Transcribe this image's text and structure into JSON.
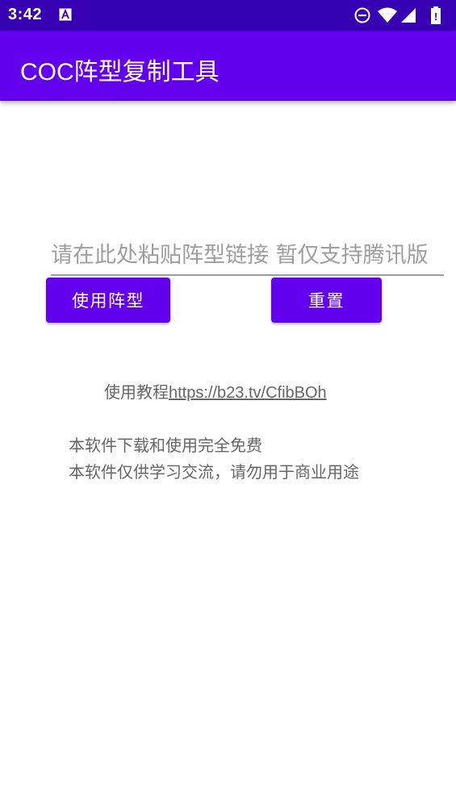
{
  "status_bar": {
    "time": "3:42",
    "colors": {
      "background": "#3700b3"
    },
    "icons": [
      "notification-a-icon",
      "do-not-disturb-icon",
      "wifi-icon",
      "signal-icon",
      "battery-icon"
    ]
  },
  "app_bar": {
    "title": "COC阵型复制工具",
    "colors": {
      "background": "#6200ee"
    }
  },
  "link_input": {
    "value": "",
    "placeholder": "请在此处粘贴阵型链接 暂仅支持腾讯版"
  },
  "buttons": {
    "use_label": "使用阵型",
    "reset_label": "重置",
    "color": "#6200ee"
  },
  "tutorial": {
    "prefix": "使用教程",
    "link": "https://b23.tv/CfibBOh"
  },
  "notice": {
    "line1": "本软件下载和使用完全免费",
    "line2": "本软件仅供学习交流，请勿用于商业用途"
  }
}
